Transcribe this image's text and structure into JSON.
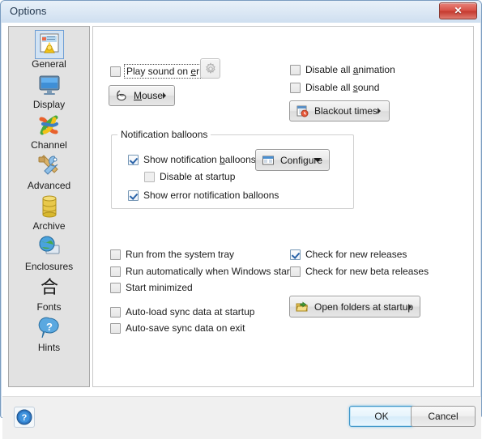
{
  "window": {
    "title": "Options",
    "close_label": "✕",
    "close_icon": "close-icon"
  },
  "sidebar": {
    "items": [
      {
        "label": "General",
        "icon": "general-icon",
        "selected": true
      },
      {
        "label": "Display",
        "icon": "display-icon",
        "selected": false
      },
      {
        "label": "Channel",
        "icon": "channel-icon",
        "selected": false
      },
      {
        "label": "Advanced",
        "icon": "advanced-icon",
        "selected": false
      },
      {
        "label": "Archive",
        "icon": "archive-icon",
        "selected": false
      },
      {
        "label": "Enclosures",
        "icon": "enclosures-icon",
        "selected": false
      },
      {
        "label": "Fonts",
        "icon": "fonts-icon",
        "selected": false
      },
      {
        "label": "Hints",
        "icon": "hints-icon",
        "selected": false
      }
    ]
  },
  "main": {
    "play_sound": {
      "label_pre": "Play sound on ",
      "label_key": "e",
      "label_post": "rror",
      "checked": false,
      "focused": true
    },
    "sound_settings_button": {
      "icon": "gear-icon",
      "disabled": true
    },
    "mouse_button": {
      "label_pre": "",
      "label_key": "M",
      "label_post": "ouse",
      "icon": "mouse-icon",
      "arrow": "▶"
    },
    "disable_animation": {
      "label_pre": "Disable all ",
      "label_key": "a",
      "label_post": "nimation",
      "checked": false
    },
    "disable_sound": {
      "label_pre": "Disable all ",
      "label_key": "s",
      "label_post": "ound",
      "checked": false
    },
    "blackout_button": {
      "label": "Blackout times",
      "icon": "blackout-icon",
      "arrow": "▶"
    },
    "group": {
      "caption": "Notification balloons",
      "show_balloons": {
        "label_pre": "Show notification ",
        "label_key": "b",
        "label_post": "alloons",
        "checked": true
      },
      "disable_at_startup": {
        "label": "Disable at startup",
        "checked": false,
        "disabled": true
      },
      "show_error_balloons": {
        "label": "Show error notification balloons",
        "checked": true
      },
      "configure_button": {
        "label": "Configure",
        "icon": "window-icon",
        "caret": "▼"
      }
    },
    "run_from_tray": {
      "label": "Run from the system tray",
      "checked": false
    },
    "run_automatically": {
      "label": "Run automatically when Windows starts",
      "checked": false
    },
    "start_minimized": {
      "label": "Start minimized",
      "checked": false
    },
    "autoload_sync": {
      "label": "Auto-load sync data at startup",
      "checked": false
    },
    "autosave_sync": {
      "label": "Auto-save sync data on exit",
      "checked": false
    },
    "check_releases": {
      "label": "Check for new releases",
      "checked": true
    },
    "check_beta": {
      "label": "Check for new beta releases",
      "checked": false
    },
    "open_folders_button": {
      "label": "Open folders at startup",
      "icon": "folder-open-icon",
      "arrow": "▶"
    }
  },
  "footer": {
    "help_label": "?",
    "help_icon": "help-icon",
    "ok_label": "OK",
    "cancel_label": "Cancel"
  },
  "colors": {
    "accent": "#2a63a8",
    "title_bar": "#dde9f5",
    "close_button": "#d9544a",
    "sidebar_bg": "#e2e2e2",
    "pane_bg": "#ffffff",
    "footer_bg": "#f0f0f0"
  }
}
